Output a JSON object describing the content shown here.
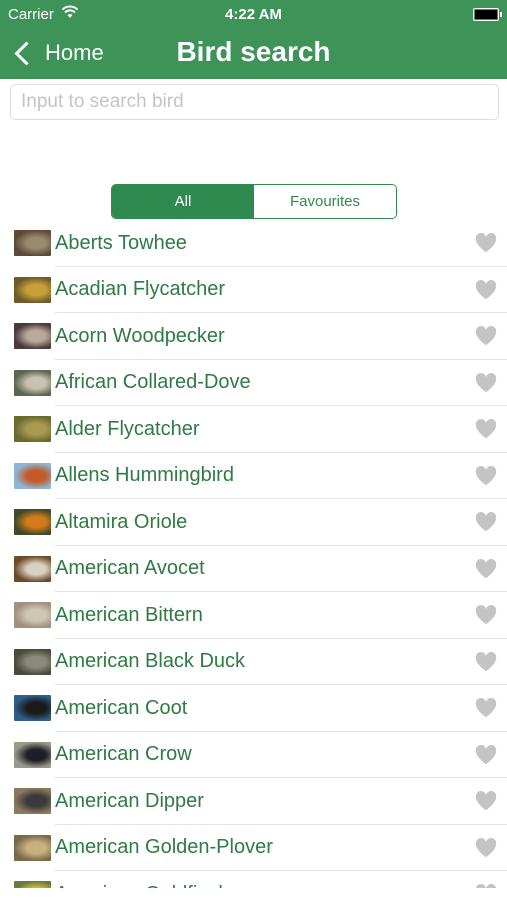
{
  "status": {
    "carrier": "Carrier",
    "time": "4:22 AM"
  },
  "nav": {
    "back_label": "Home",
    "title": "Bird search"
  },
  "search": {
    "placeholder": "Input to search bird",
    "value": ""
  },
  "segment": {
    "options": [
      "All",
      "Favourites"
    ],
    "selected": "All"
  },
  "birds": [
    "Aberts Towhee",
    "Acadian Flycatcher",
    "Acorn Woodpecker",
    "African Collared-Dove",
    "Alder Flycatcher",
    "Allens Hummingbird",
    "Altamira Oriole",
    "American Avocet",
    "American Bittern",
    "American Black Duck",
    "American Coot",
    "American Crow",
    "American Dipper",
    "American Golden-Plover",
    "American Goldfinch"
  ],
  "colors": {
    "accent": "#3d9358",
    "item_text": "#2f7a45",
    "heart": "#c4c4c4"
  }
}
